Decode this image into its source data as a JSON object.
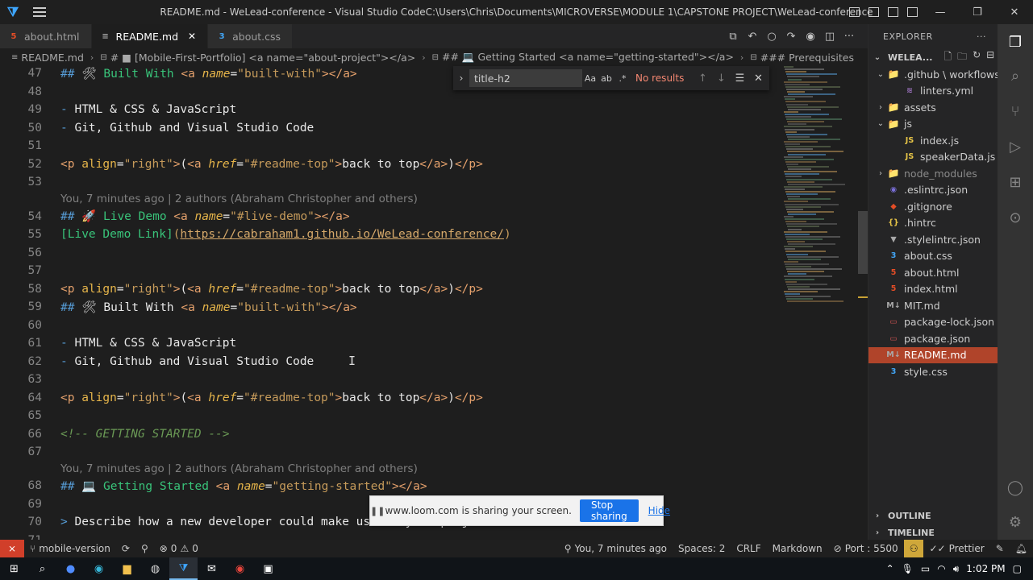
{
  "window": {
    "title": "README.md - WeLead-conference - Visual Studio CodeC:\\Users\\Chris\\Documents\\MICROVERSE\\MODULE 1\\CAPSTONE PROJECT\\WeLead-conference",
    "minimize": "—",
    "maximize": "❐",
    "close": "✕"
  },
  "tabs": [
    {
      "label": "about.html",
      "icon": "5",
      "icon_name": "html-file-icon"
    },
    {
      "label": "README.md",
      "icon": "≡",
      "icon_name": "markdown-file-icon",
      "active": true
    },
    {
      "label": "about.css",
      "icon": "3",
      "icon_name": "css-file-icon"
    }
  ],
  "breadcrumb": {
    "file": "README.md",
    "items": [
      "# ■ [Mobile-First-Portfolio] <a name=\"about-project\"></a>",
      "## 💻 Getting Started <a name=\"getting-started\"></a>",
      "### Prerequisites"
    ]
  },
  "find": {
    "query": "title-h2",
    "match_case": "Aa",
    "whole_word": "ab",
    "regex": ".*",
    "results": "No results"
  },
  "code": {
    "l47": {
      "num": "47",
      "hash": "## ",
      "emoji": "🛠",
      "title": " Built With ",
      "tag_open": "<a ",
      "attr": "name",
      "eq": "=",
      "val": "\"built-with\"",
      "tag_close": "></a>"
    },
    "l48": {
      "num": "48"
    },
    "l49": {
      "num": "49",
      "dash": "- ",
      "text": "HTML & CSS & JavaScript"
    },
    "l50": {
      "num": "50",
      "dash": "- ",
      "text": "Git, Github and Visual Studio Code"
    },
    "l51": {
      "num": "51"
    },
    "l52": {
      "num": "52",
      "p_open": "<p ",
      "align_attr": "align",
      "eq": "=",
      "align_val": "\"right\"",
      "gt": ">",
      "paren": "(",
      "a_open": "<a ",
      "href_attr": "href",
      "href_val": "\"#readme-top\"",
      "link_text": "back to top",
      "a_close": "</a>",
      "paren_close": ")",
      "p_close": "</p>"
    },
    "l53": {
      "num": "53"
    },
    "blame1": "You, 7 minutes ago | 2 authors (Abraham Christopher and others)",
    "l54": {
      "num": "54",
      "hash": "## ",
      "emoji": "🚀",
      "title": " Live Demo ",
      "tag_open": "<a ",
      "attr": "name",
      "eq": "=",
      "val": "\"#live-demo\"",
      "tag_close": "></a>"
    },
    "l55": {
      "num": "55",
      "link_label": "[Live Demo Link]",
      "url_open": "(",
      "url": "https://cabraham1.github.io/WeLead-conference/",
      "url_close": ")"
    },
    "l56": {
      "num": "56"
    },
    "l57": {
      "num": "57"
    },
    "l58": {
      "num": "58",
      "p_open": "<p ",
      "align_attr": "align",
      "eq": "=",
      "align_val": "\"right\"",
      "gt": ">",
      "paren": "(",
      "a_open": "<a ",
      "href_attr": "href",
      "href_val": "\"#readme-top\"",
      "link_text": "back to top",
      "a_close": "</a>",
      "paren_close": ")",
      "p_close": "</p>"
    },
    "l59": {
      "num": "59",
      "hash": "## ",
      "emoji": "🛠",
      "title": " Built With ",
      "tag_open": "<a ",
      "attr": "name",
      "eq": "=",
      "val": "\"built-with\"",
      "tag_close": "></a>"
    },
    "l60": {
      "num": "60"
    },
    "l61": {
      "num": "61",
      "dash": "- ",
      "text": "HTML & CSS & JavaScript"
    },
    "l62": {
      "num": "62",
      "dash": "- ",
      "text": "Git, Github and Visual Studio Code"
    },
    "l63": {
      "num": "63"
    },
    "l64": {
      "num": "64",
      "p_open": "<p ",
      "align_attr": "align",
      "eq": "=",
      "align_val": "\"right\"",
      "gt": ">",
      "paren": "(",
      "a_open": "<a ",
      "href_attr": "href",
      "href_val": "\"#readme-top\"",
      "link_text": "back to top",
      "a_close": "</a>",
      "paren_close": ")",
      "p_close": "</p>"
    },
    "l65": {
      "num": "65"
    },
    "l66": {
      "num": "66",
      "comment": "<!-- GETTING STARTED -->"
    },
    "l67": {
      "num": "67"
    },
    "blame2": "You, 7 minutes ago | 2 authors (Abraham Christopher and others)",
    "l68": {
      "num": "68",
      "hash": "## ",
      "emoji": "💻",
      "title": " Getting Started ",
      "tag_open": "<a ",
      "attr": "name",
      "eq": "=",
      "val": "\"getting-started\"",
      "tag_close": "></a>"
    },
    "l69": {
      "num": "69"
    },
    "l70": {
      "num": "70",
      "quote": "> ",
      "text": "Describe how a new developer could make use of your project."
    },
    "l71": {
      "num": "71"
    }
  },
  "explorer": {
    "title": "EXPLORER",
    "more": "···",
    "workspace": "WELEA...",
    "items": [
      {
        "label": ".github \\ workflows",
        "level": 1,
        "chevron": "⌄",
        "icon": "📁",
        "kind": "folder"
      },
      {
        "label": "linters.yml",
        "level": 2,
        "icon": "≋",
        "kind": "yml"
      },
      {
        "label": "assets",
        "level": 1,
        "chevron": "›",
        "icon": "📁",
        "kind": "folder"
      },
      {
        "label": "js",
        "level": 1,
        "chevron": "⌄",
        "icon": "📁",
        "kind": "folder"
      },
      {
        "label": "index.js",
        "level": 2,
        "icon": "JS",
        "kind": "js"
      },
      {
        "label": "speakerData.js",
        "level": 2,
        "icon": "JS",
        "kind": "js"
      },
      {
        "label": "node_modules",
        "level": 1,
        "chevron": "›",
        "icon": "📁",
        "kind": "folder",
        "dim": true
      },
      {
        "label": ".eslintrc.json",
        "level": 1,
        "icon": "◉",
        "kind": "eslint"
      },
      {
        "label": ".gitignore",
        "level": 1,
        "icon": "◆",
        "kind": "git"
      },
      {
        "label": ".hintrc",
        "level": 1,
        "icon": "{}",
        "kind": "json"
      },
      {
        "label": ".stylelintrc.json",
        "level": 1,
        "icon": "▼",
        "kind": "md"
      },
      {
        "label": "about.css",
        "level": 1,
        "icon": "3",
        "kind": "css"
      },
      {
        "label": "about.html",
        "level": 1,
        "icon": "5",
        "kind": "html"
      },
      {
        "label": "index.html",
        "level": 1,
        "icon": "5",
        "kind": "html"
      },
      {
        "label": "MIT.md",
        "level": 1,
        "icon": "M↓",
        "kind": "md"
      },
      {
        "label": "package-lock.json",
        "level": 1,
        "icon": "▭",
        "kind": "pkg"
      },
      {
        "label": "package.json",
        "level": 1,
        "icon": "▭",
        "kind": "pkg"
      },
      {
        "label": "README.md",
        "level": 1,
        "icon": "M↓",
        "kind": "md",
        "selected": true
      },
      {
        "label": "style.css",
        "level": 1,
        "icon": "3",
        "kind": "css"
      }
    ],
    "outline": "OUTLINE",
    "timeline": "TIMELINE"
  },
  "statusbar": {
    "remote": "⨯",
    "branch": "mobile-version",
    "sync": "⟳",
    "errors": "0",
    "warnings": "0",
    "blame": "You, 7 minutes ago",
    "spaces": "Spaces: 2",
    "eol": "CRLF",
    "language": "Markdown",
    "port": "Port : 5500",
    "prettier": "Prettier"
  },
  "loom": {
    "text": "www.loom.com is sharing your screen.",
    "stop": "Stop sharing",
    "hide": "Hide"
  },
  "taskbar": {
    "time": "1:02 PM"
  },
  "colors": {
    "accent": "#007acc",
    "selected_file": "#b0442a",
    "loom_button": "#1a73e8",
    "remote": "#d13f2a"
  }
}
